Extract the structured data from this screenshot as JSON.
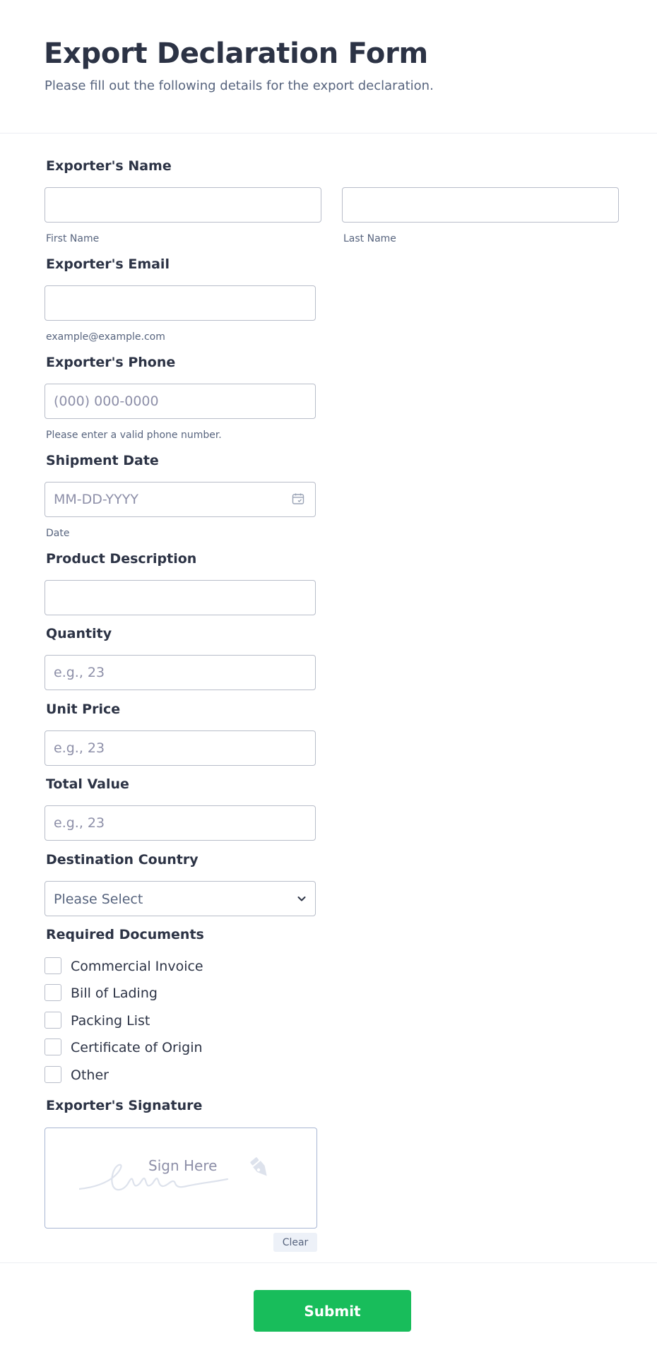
{
  "header": {
    "title": "Export Declaration Form",
    "subtitle": "Please fill out the following details for the export declaration."
  },
  "fields": {
    "name": {
      "label": "Exporter's Name",
      "first_sublabel": "First Name",
      "last_sublabel": "Last Name",
      "first_value": "",
      "last_value": ""
    },
    "email": {
      "label": "Exporter's Email",
      "value": "",
      "sublabel": "example@example.com"
    },
    "phone": {
      "label": "Exporter's Phone",
      "placeholder": "(000) 000-0000",
      "sublabel": "Please enter a valid phone number."
    },
    "shipment_date": {
      "label": "Shipment Date",
      "placeholder": "MM-DD-YYYY",
      "sublabel": "Date",
      "icon": "calendar-icon"
    },
    "product_description": {
      "label": "Product Description",
      "value": ""
    },
    "quantity": {
      "label": "Quantity",
      "placeholder": "e.g., 23"
    },
    "unit_price": {
      "label": "Unit Price",
      "placeholder": "e.g., 23"
    },
    "total_value": {
      "label": "Total Value",
      "placeholder": "e.g., 23"
    },
    "destination_country": {
      "label": "Destination Country",
      "selected": "Please Select",
      "icon": "chevron-down-icon"
    },
    "required_documents": {
      "label": "Required Documents",
      "options": [
        {
          "label": "Commercial Invoice",
          "checked": false
        },
        {
          "label": "Bill of Lading",
          "checked": false
        },
        {
          "label": "Packing List",
          "checked": false
        },
        {
          "label": "Certificate of Origin",
          "checked": false
        },
        {
          "label": "Other",
          "checked": false
        }
      ]
    },
    "signature": {
      "label": "Exporter's Signature",
      "placeholder": "Sign Here",
      "clear_label": "Clear",
      "icon": "pen-icon"
    }
  },
  "footer": {
    "submit_label": "Submit"
  },
  "colors": {
    "text": "#2c3345",
    "muted": "#57647e",
    "placeholder": "#8d8fa8",
    "border": "#b8bdc9",
    "submit": "#18bd5b",
    "clear_bg": "#edf1f8"
  }
}
